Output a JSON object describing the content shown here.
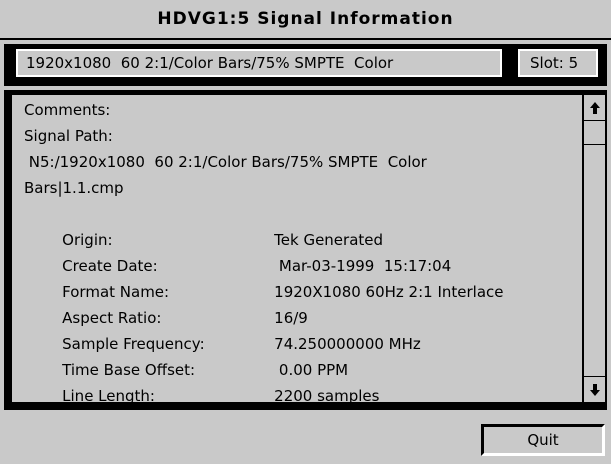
{
  "window": {
    "title": "HDVG1:5  Signal Information"
  },
  "signal_bar": {
    "signal_name": "1920x1080  60 2:1/Color Bars/75% SMPTE  Color",
    "slot": "Slot: 5"
  },
  "info": {
    "comments_label": "Comments:",
    "signal_path_label": "Signal Path:",
    "signal_path_line1": " N5:/1920x1080  60 2:1/Color Bars/75% SMPTE  Color",
    "signal_path_line2": "Bars|1.1.cmp",
    "rows": [
      {
        "label": "Origin:",
        "value": "Tek Generated"
      },
      {
        "label": "Create Date:",
        "value": " Mar-03-1999  15:17:04"
      },
      {
        "label": "Format Name:",
        "value": "1920X1080 60Hz 2:1 Interlace"
      },
      {
        "label": "Aspect Ratio:",
        "value": "16/9"
      },
      {
        "label": "Sample Frequency:",
        "value": "74.250000000 MHz"
      },
      {
        "label": "Time Base Offset:",
        "value": " 0.00 PPM"
      },
      {
        "label": "Line Length:",
        "value": "2200 samples"
      }
    ]
  },
  "scrollbar": {
    "up_icon": "arrow-up-icon",
    "down_icon": "arrow-down-icon"
  },
  "buttons": {
    "quit_label": "Quit"
  }
}
